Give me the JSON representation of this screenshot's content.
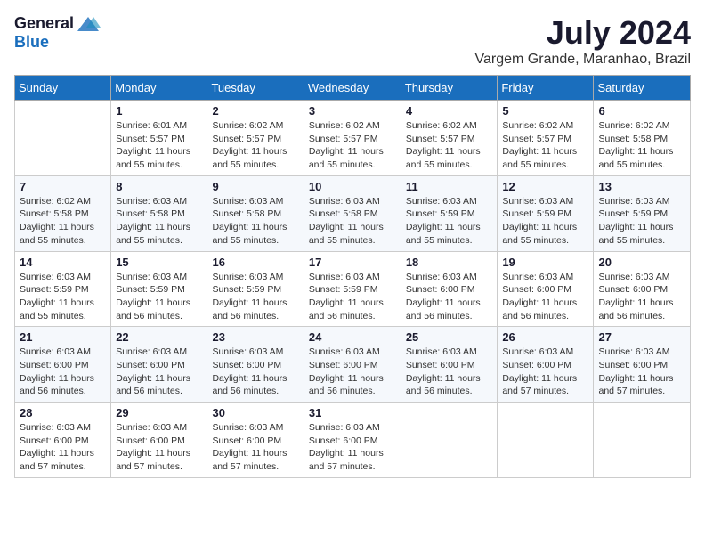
{
  "header": {
    "logo_general": "General",
    "logo_blue": "Blue",
    "month_year": "July 2024",
    "location": "Vargem Grande, Maranhao, Brazil"
  },
  "calendar": {
    "days_of_week": [
      "Sunday",
      "Monday",
      "Tuesday",
      "Wednesday",
      "Thursday",
      "Friday",
      "Saturday"
    ],
    "weeks": [
      [
        {
          "day": "",
          "info": ""
        },
        {
          "day": "1",
          "info": "Sunrise: 6:01 AM\nSunset: 5:57 PM\nDaylight: 11 hours\nand 55 minutes."
        },
        {
          "day": "2",
          "info": "Sunrise: 6:02 AM\nSunset: 5:57 PM\nDaylight: 11 hours\nand 55 minutes."
        },
        {
          "day": "3",
          "info": "Sunrise: 6:02 AM\nSunset: 5:57 PM\nDaylight: 11 hours\nand 55 minutes."
        },
        {
          "day": "4",
          "info": "Sunrise: 6:02 AM\nSunset: 5:57 PM\nDaylight: 11 hours\nand 55 minutes."
        },
        {
          "day": "5",
          "info": "Sunrise: 6:02 AM\nSunset: 5:57 PM\nDaylight: 11 hours\nand 55 minutes."
        },
        {
          "day": "6",
          "info": "Sunrise: 6:02 AM\nSunset: 5:58 PM\nDaylight: 11 hours\nand 55 minutes."
        }
      ],
      [
        {
          "day": "7",
          "info": "Sunrise: 6:02 AM\nSunset: 5:58 PM\nDaylight: 11 hours\nand 55 minutes."
        },
        {
          "day": "8",
          "info": "Sunrise: 6:03 AM\nSunset: 5:58 PM\nDaylight: 11 hours\nand 55 minutes."
        },
        {
          "day": "9",
          "info": "Sunrise: 6:03 AM\nSunset: 5:58 PM\nDaylight: 11 hours\nand 55 minutes."
        },
        {
          "day": "10",
          "info": "Sunrise: 6:03 AM\nSunset: 5:58 PM\nDaylight: 11 hours\nand 55 minutes."
        },
        {
          "day": "11",
          "info": "Sunrise: 6:03 AM\nSunset: 5:59 PM\nDaylight: 11 hours\nand 55 minutes."
        },
        {
          "day": "12",
          "info": "Sunrise: 6:03 AM\nSunset: 5:59 PM\nDaylight: 11 hours\nand 55 minutes."
        },
        {
          "day": "13",
          "info": "Sunrise: 6:03 AM\nSunset: 5:59 PM\nDaylight: 11 hours\nand 55 minutes."
        }
      ],
      [
        {
          "day": "14",
          "info": "Sunrise: 6:03 AM\nSunset: 5:59 PM\nDaylight: 11 hours\nand 55 minutes."
        },
        {
          "day": "15",
          "info": "Sunrise: 6:03 AM\nSunset: 5:59 PM\nDaylight: 11 hours\nand 56 minutes."
        },
        {
          "day": "16",
          "info": "Sunrise: 6:03 AM\nSunset: 5:59 PM\nDaylight: 11 hours\nand 56 minutes."
        },
        {
          "day": "17",
          "info": "Sunrise: 6:03 AM\nSunset: 5:59 PM\nDaylight: 11 hours\nand 56 minutes."
        },
        {
          "day": "18",
          "info": "Sunrise: 6:03 AM\nSunset: 6:00 PM\nDaylight: 11 hours\nand 56 minutes."
        },
        {
          "day": "19",
          "info": "Sunrise: 6:03 AM\nSunset: 6:00 PM\nDaylight: 11 hours\nand 56 minutes."
        },
        {
          "day": "20",
          "info": "Sunrise: 6:03 AM\nSunset: 6:00 PM\nDaylight: 11 hours\nand 56 minutes."
        }
      ],
      [
        {
          "day": "21",
          "info": "Sunrise: 6:03 AM\nSunset: 6:00 PM\nDaylight: 11 hours\nand 56 minutes."
        },
        {
          "day": "22",
          "info": "Sunrise: 6:03 AM\nSunset: 6:00 PM\nDaylight: 11 hours\nand 56 minutes."
        },
        {
          "day": "23",
          "info": "Sunrise: 6:03 AM\nSunset: 6:00 PM\nDaylight: 11 hours\nand 56 minutes."
        },
        {
          "day": "24",
          "info": "Sunrise: 6:03 AM\nSunset: 6:00 PM\nDaylight: 11 hours\nand 56 minutes."
        },
        {
          "day": "25",
          "info": "Sunrise: 6:03 AM\nSunset: 6:00 PM\nDaylight: 11 hours\nand 56 minutes."
        },
        {
          "day": "26",
          "info": "Sunrise: 6:03 AM\nSunset: 6:00 PM\nDaylight: 11 hours\nand 57 minutes."
        },
        {
          "day": "27",
          "info": "Sunrise: 6:03 AM\nSunset: 6:00 PM\nDaylight: 11 hours\nand 57 minutes."
        }
      ],
      [
        {
          "day": "28",
          "info": "Sunrise: 6:03 AM\nSunset: 6:00 PM\nDaylight: 11 hours\nand 57 minutes."
        },
        {
          "day": "29",
          "info": "Sunrise: 6:03 AM\nSunset: 6:00 PM\nDaylight: 11 hours\nand 57 minutes."
        },
        {
          "day": "30",
          "info": "Sunrise: 6:03 AM\nSunset: 6:00 PM\nDaylight: 11 hours\nand 57 minutes."
        },
        {
          "day": "31",
          "info": "Sunrise: 6:03 AM\nSunset: 6:00 PM\nDaylight: 11 hours\nand 57 minutes."
        },
        {
          "day": "",
          "info": ""
        },
        {
          "day": "",
          "info": ""
        },
        {
          "day": "",
          "info": ""
        }
      ]
    ]
  }
}
